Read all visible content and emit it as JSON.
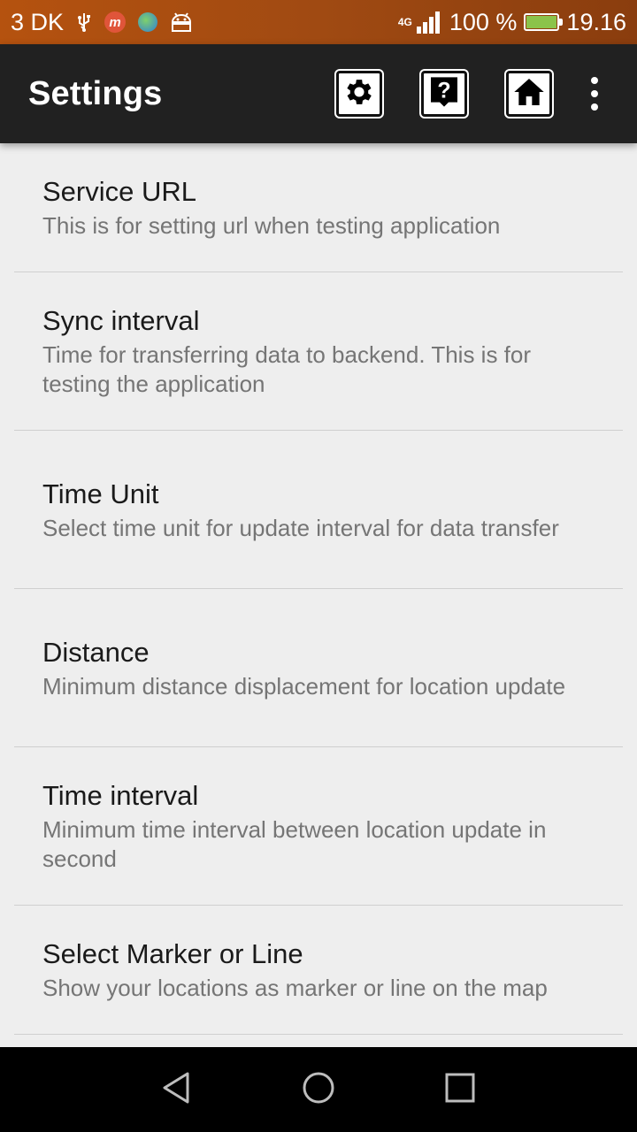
{
  "status_bar": {
    "carrier": "3 DK",
    "network": "4G",
    "battery": "100 %",
    "time": "19.16",
    "accent": "#b5520f"
  },
  "action_bar": {
    "title": "Settings",
    "icons": [
      "settings-icon",
      "help-icon",
      "home-icon",
      "overflow-menu-icon"
    ]
  },
  "preferences": [
    {
      "title": "Service URL",
      "summary": "This is for setting url when testing application"
    },
    {
      "title": "Sync interval",
      "summary": "Time for transferring data to backend. This is for testing the application"
    },
    {
      "title": "Time Unit",
      "summary": "Select time unit for update interval for data transfer"
    },
    {
      "title": "Distance",
      "summary": "Minimum distance displacement for location update"
    },
    {
      "title": "Time interval",
      "summary": "Minimum time interval between location update in second"
    },
    {
      "title": "Select Marker or Line",
      "summary": "Show your locations as marker or line on the map"
    }
  ],
  "nav_bar": {
    "buttons": [
      "back-icon",
      "home-circle-icon",
      "recents-icon"
    ]
  }
}
